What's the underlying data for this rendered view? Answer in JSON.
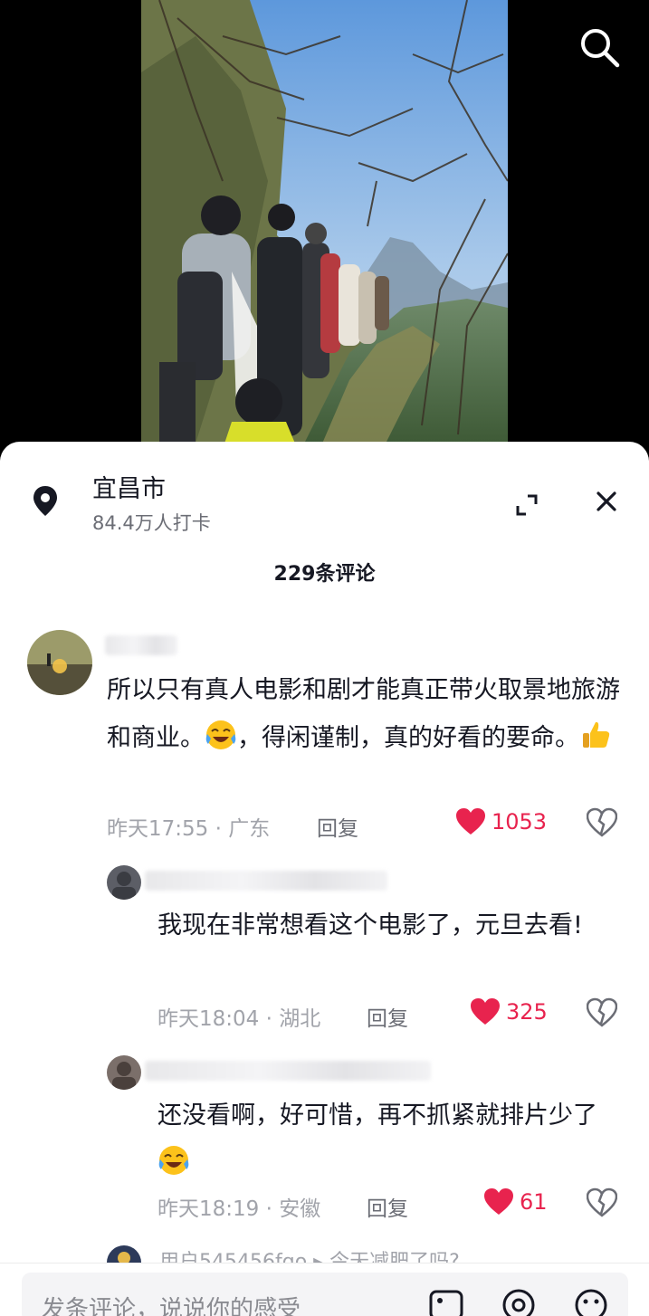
{
  "location": {
    "name": "宜昌市",
    "checkins": "84.4万人打卡"
  },
  "comments_count": "229条评论",
  "comments": [
    {
      "text_before": "所以只有真人电影和剧才能真正带火取景地旅游和商业。",
      "text_mid": "，得闲谨制，真的好看的要命。",
      "time": "昨天17:55 · 广东",
      "reply": "回复",
      "likes": "1053",
      "emoji1": "laugh-cry-emoji",
      "emoji2": "thumbs-up-emoji"
    },
    {
      "text": "我现在非常想看这个电影了，元旦去看!",
      "time": "昨天18:04 · 湖北",
      "reply": "回复",
      "likes": "325"
    },
    {
      "text": "还没看啊，好可惜，再不抓紧就排片少了",
      "time": "昨天18:19 · 安徽",
      "reply": "回复",
      "likes": "61",
      "emoji": "laugh-cry-emoji"
    }
  ],
  "partial_comment": "用户545456fgo ▸ 今天减肥了吗?",
  "input": {
    "placeholder": "发条评论，说说你的感受"
  },
  "colors": {
    "like": "#e8234e",
    "meta": "#a1a3aa",
    "text": "#161823"
  },
  "icons": [
    "search-icon",
    "location-pin-icon",
    "expand-icon",
    "close-icon",
    "heart-icon",
    "dislike-heart-icon",
    "image-icon",
    "at-icon",
    "emoji-icon"
  ]
}
